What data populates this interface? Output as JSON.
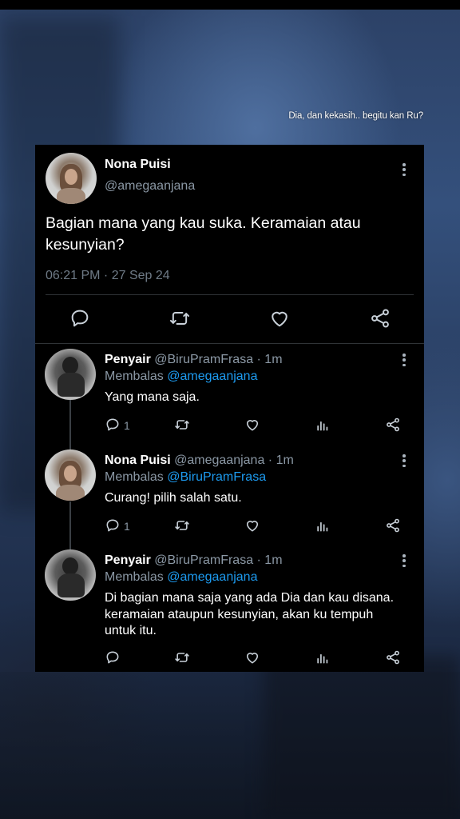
{
  "caption": "Dia, dan kekasih.. begitu kan Ru?",
  "main_tweet": {
    "name": "Nona Puisi",
    "handle": "@amegaanjana",
    "text": "Bagian mana yang kau suka. Keramaian atau kesunyian?",
    "timestamp": "06:21 PM · 27 Sep 24",
    "actions": [
      "reply-icon",
      "retweet-icon",
      "like-icon",
      "share-icon"
    ]
  },
  "replies": [
    {
      "name": "Penyair",
      "handle_time": "@BiruPramFrasa · 1m",
      "replying_label": "Membalas",
      "replying_to": "@amegaanjana",
      "text": "Yang mana saja.",
      "reply_count": "1"
    },
    {
      "name": "Nona Puisi",
      "handle_time": "@amegaanjana · 1m",
      "replying_label": "Membalas",
      "replying_to": "@BiruPramFrasa",
      "text": "Curang! pilih salah satu.",
      "reply_count": "1"
    },
    {
      "name": "Penyair",
      "handle_time": "@BiruPramFrasa · 1m",
      "replying_label": "Membalas",
      "replying_to": "@amegaanjana",
      "text": "Di bagian mana saja yang ada Dia dan kau disana. keramaian ataupun kesunyian, akan ku tempuh untuk itu.",
      "reply_count": ""
    }
  ],
  "colors": {
    "card_bg": "#000000",
    "text_primary": "#ffffff",
    "text_secondary": "#8b98a5",
    "mention": "#1d9bf0",
    "divider": "#2f3336"
  }
}
